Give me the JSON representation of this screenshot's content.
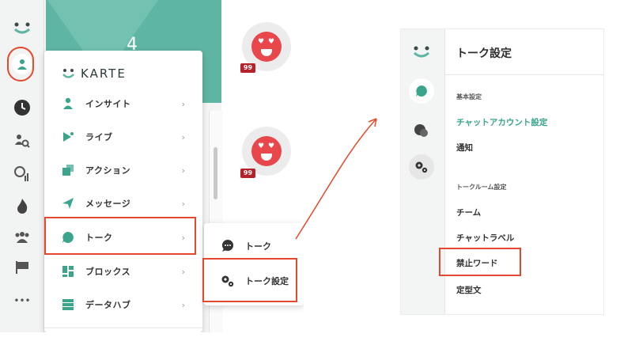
{
  "left": {
    "brand": "KARTE",
    "tile_number": "4",
    "badge_count": "99",
    "menu_items": [
      {
        "label": "インサイト",
        "icon": "person-icon"
      },
      {
        "label": "ライブ",
        "icon": "live-icon"
      },
      {
        "label": "アクション",
        "icon": "action-icon"
      },
      {
        "label": "メッセージ",
        "icon": "paper-plane-icon"
      },
      {
        "label": "トーク",
        "icon": "talk-bubble-icon"
      },
      {
        "label": "ブロックス",
        "icon": "blocks-icon"
      },
      {
        "label": "データハブ",
        "icon": "datahub-icon"
      }
    ],
    "submenu_items": [
      {
        "label": "トーク",
        "icon": "chat-icon"
      },
      {
        "label": "トーク設定",
        "icon": "gears-icon"
      }
    ],
    "chevron": "›",
    "more": "•••"
  },
  "right": {
    "title": "トーク設定",
    "sections": [
      {
        "label": "基本設定",
        "items": [
          "チャットアカウント設定",
          "通知"
        ]
      },
      {
        "label": "トークルーム設定",
        "items": [
          "チーム",
          "チャットラベル",
          "禁止ワード",
          "定型文"
        ]
      }
    ]
  },
  "colors": {
    "accent": "#3aa58c",
    "highlight": "#e4492d",
    "teal": "#5fb5a3",
    "badge": "#b7212a"
  }
}
